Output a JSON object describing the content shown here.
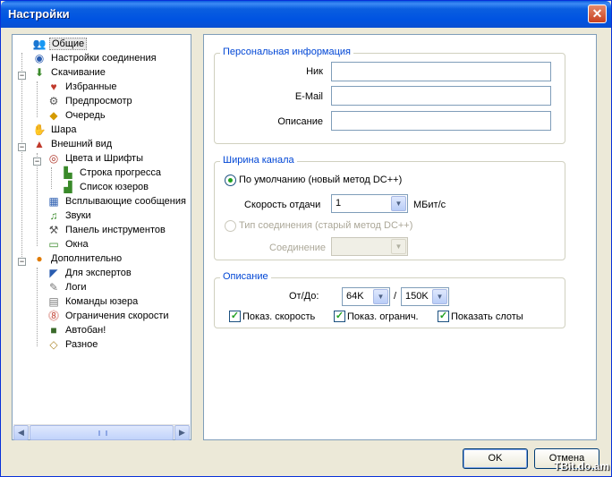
{
  "window": {
    "title": "Настройки",
    "close_glyph": "✕"
  },
  "tree": {
    "items": [
      {
        "label": "Общие",
        "icon": "general-icon"
      },
      {
        "label": "Настройки соединения",
        "icon": "connection-icon"
      },
      {
        "label": "Скачивание",
        "icon": "download-icon"
      },
      {
        "label": "Избранные",
        "icon": "favorites-icon"
      },
      {
        "label": "Предпросмотр",
        "icon": "preview-icon"
      },
      {
        "label": "Очередь",
        "icon": "queue-icon"
      },
      {
        "label": "Шара",
        "icon": "share-icon"
      },
      {
        "label": "Внешний вид",
        "icon": "appearance-icon"
      },
      {
        "label": "Цвета и Шрифты",
        "icon": "colors-icon"
      },
      {
        "label": "Строка прогресса",
        "icon": "progressbar-icon"
      },
      {
        "label": "Список юзеров",
        "icon": "userlist-icon"
      },
      {
        "label": "Всплывающие сообщения",
        "icon": "popup-icon"
      },
      {
        "label": "Звуки",
        "icon": "sounds-icon"
      },
      {
        "label": "Панель инструментов",
        "icon": "toolbar-icon"
      },
      {
        "label": "Окна",
        "icon": "windows-icon"
      },
      {
        "label": "Дополнительно",
        "icon": "advanced-icon"
      },
      {
        "label": "Для экспертов",
        "icon": "experts-icon"
      },
      {
        "label": "Логи",
        "icon": "logs-icon"
      },
      {
        "label": "Команды юзера",
        "icon": "user-commands-icon"
      },
      {
        "label": "Ограничения скорости",
        "icon": "speed-limit-icon"
      },
      {
        "label": "Автобан!",
        "icon": "autoban-icon"
      },
      {
        "label": "Разное",
        "icon": "misc-icon"
      }
    ],
    "expander_minus": "−",
    "scroll_left": "◀",
    "scroll_right": "▶"
  },
  "personal": {
    "legend": "Персональная информация",
    "nick_label": "Ник",
    "nick_value": "",
    "email_label": "E-Mail",
    "email_value": "",
    "desc_label": "Описание",
    "desc_value": ""
  },
  "bandwidth": {
    "legend": "Ширина канала",
    "default_radio_label": "По умолчанию (новый метод DC++)",
    "upload_label": "Скорость отдачи",
    "upload_value": "1",
    "upload_unit": "МБит/с",
    "conn_type_radio_label": "Тип соединения (старый метод DC++)",
    "connection_label": "Соединение",
    "connection_value": ""
  },
  "description": {
    "legend": "Описание",
    "from_to_label": "От/До:",
    "from_value": "64K",
    "separator": "/",
    "to_value": "150K",
    "show_speed_label": "Показ. скорость",
    "show_limits_label": "Показ. огранич.",
    "show_slots_label": "Показать слоты",
    "check_glyph": "✓"
  },
  "buttons": {
    "ok": "OK",
    "cancel": "Отмена"
  },
  "dropdown_arrow": "▼",
  "watermark": "TBit.do.am",
  "colors": {
    "accent": "#0046d5",
    "titlebar": "#0a5ee0",
    "check": "#21a121"
  }
}
